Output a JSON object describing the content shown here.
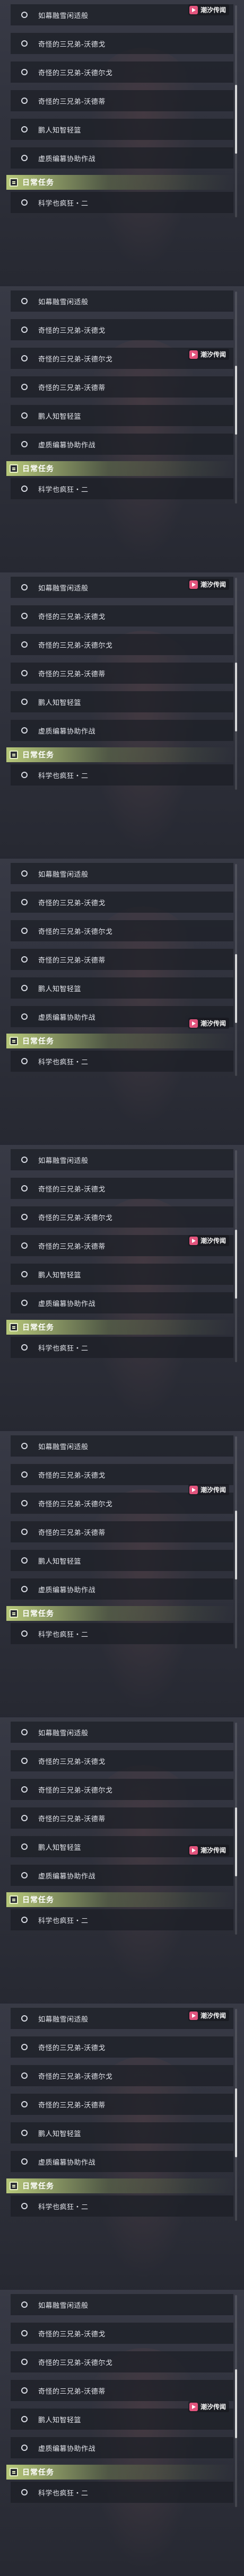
{
  "quest_items": [
    "如幕融雪闲适般",
    "奇怪的三兄弟-沃德戈",
    "奇怪的三兄弟-沃德尔戈",
    "奇怪的三兄弟-沃德蒂",
    "鹏人知智轻篮",
    "虚质编篡协助作战"
  ],
  "section_header": "日常任务",
  "section_items": [
    "科学也疯狂・二"
  ],
  "watermark": "潮汐传闻",
  "panel_count": 9,
  "colors": {
    "header_accent": "#b7c87a",
    "watermark_logo": "#e2547d"
  }
}
